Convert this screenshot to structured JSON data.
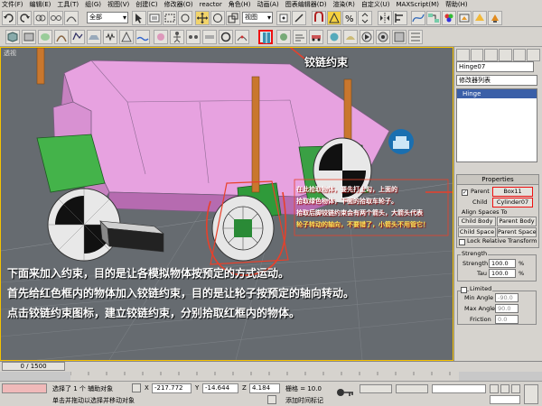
{
  "menubar": [
    "文件(F)",
    "编辑(E)",
    "工具(T)",
    "组(G)",
    "视图(V)",
    "创建(C)",
    "修改器(O)",
    "reactor",
    "角色(H)",
    "动画(A)",
    "图表编辑器(D)",
    "渲染(R)",
    "自定义(U)",
    "MAXScript(M)",
    "帮助(H)"
  ],
  "toolbar1": {
    "selection_filter": "全部",
    "coord_system": "视图"
  },
  "viewport": {
    "label": "透视"
  },
  "annotations": {
    "title": "铰链约束",
    "note": [
      "在此拾取物体，要先打上勾，上面的",
      "拾取绿色物体，下面的拾取车轮子。",
      "拾取后脚铰链约束会有两个箭头，大箭头代表",
      "轮子转动的轴向，不要错了，小箭头不用管它！"
    ],
    "tutorial": [
      "下面来加入约束，目的是让各模拟物体按预定的方式运动。",
      "首先给红色框内的物体加入铰链约束，目的是让轮子按预定的轴向转动。",
      "点击铰链约束图标，建立铰链约束，分别拾取红框内的物体。"
    ]
  },
  "cmdpanel": {
    "object_name": "Hinge07",
    "modifier_list": "修改器列表",
    "stack_item": "Hinge",
    "properties_title": "Properties",
    "parent_label": "Parent",
    "parent_value": "Box11",
    "child_label": "Child",
    "child_value": "Cylinder07",
    "align_title": "Align Spaces To",
    "btn_child_body": "Child Body",
    "btn_parent_body": "Parent Body",
    "btn_child_space": "Child Space",
    "btn_parent_space": "Parent Space",
    "lock_relative": "Lock Relative Transform",
    "strength_title": "Strength",
    "strength_label": "Strength",
    "strength_value": "100.0",
    "tau_label": "Tau",
    "tau_value": "100.0",
    "pct": "%",
    "limited_label": "Limited",
    "min_angle_label": "Min Angle",
    "min_angle_value": "-90.0",
    "max_angle_label": "Max Angle",
    "max_angle_value": "90.0",
    "friction_label": "Friction",
    "friction_value": "0.0"
  },
  "timeline": {
    "slider": "0 / 1500"
  },
  "statusbar": {
    "selected": "选择了 1 个 辅助对象",
    "hint": "单击并拖动以选择并移动对象",
    "x_label": "X",
    "x_value": "-217.772",
    "y_label": "Y",
    "y_value": "-14.644",
    "z_label": "Z",
    "z_value": "4.184",
    "grid": "栅格 = 10.0",
    "add_time_tag": "添加时间标记"
  }
}
